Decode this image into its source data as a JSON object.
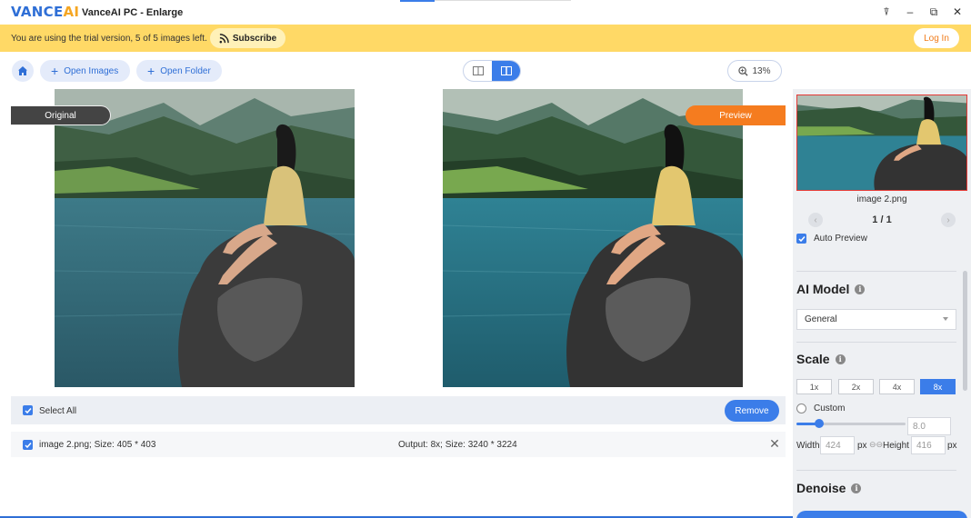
{
  "window": {
    "logo_text": "VANCE",
    "logo_ai": "AI",
    "title": "VanceAI PC - Enlarge",
    "controls": {
      "pin": "⍒",
      "minimize": "–",
      "restore": "⧉",
      "close": "✕"
    }
  },
  "banner": {
    "text": "You are using the trial version, 5 of 5 images left.",
    "subscribe_label": "Subscribe",
    "login_label": "Log In"
  },
  "toolbar": {
    "open_images_label": "Open Images",
    "open_folder_label": "Open Folder",
    "zoom_label": "13%",
    "view_mode": "split"
  },
  "compare": {
    "original_label": "Original",
    "preview_label": "Preview"
  },
  "file_list": {
    "select_all_label": "Select All",
    "remove_label": "Remove",
    "rows": [
      {
        "name": "image 2.png; Size: 405 * 403",
        "output": "Output: 8x; Size: 3240 * 3224",
        "checked": true
      }
    ]
  },
  "panel": {
    "thumbnail_name": "image 2.png",
    "pager_text": "1 / 1",
    "auto_preview_label": "Auto Preview",
    "auto_preview_checked": true,
    "ai_model_title": "AI Model",
    "ai_model_value": "General",
    "scale_title": "Scale",
    "scale_options": [
      "1x",
      "2x",
      "4x",
      "8x"
    ],
    "scale_selected": "8x",
    "custom_label": "Custom",
    "custom_value": "8.0",
    "width_label": "Width",
    "width_value": "424",
    "height_label": "Height",
    "height_value": "416",
    "unit_px": "px",
    "denoise_title": "Denoise"
  },
  "colors": {
    "accent": "#3b7de9",
    "banner": "#ffd966",
    "preview_tag": "#f57c1f",
    "login_text": "#f07c1a"
  }
}
